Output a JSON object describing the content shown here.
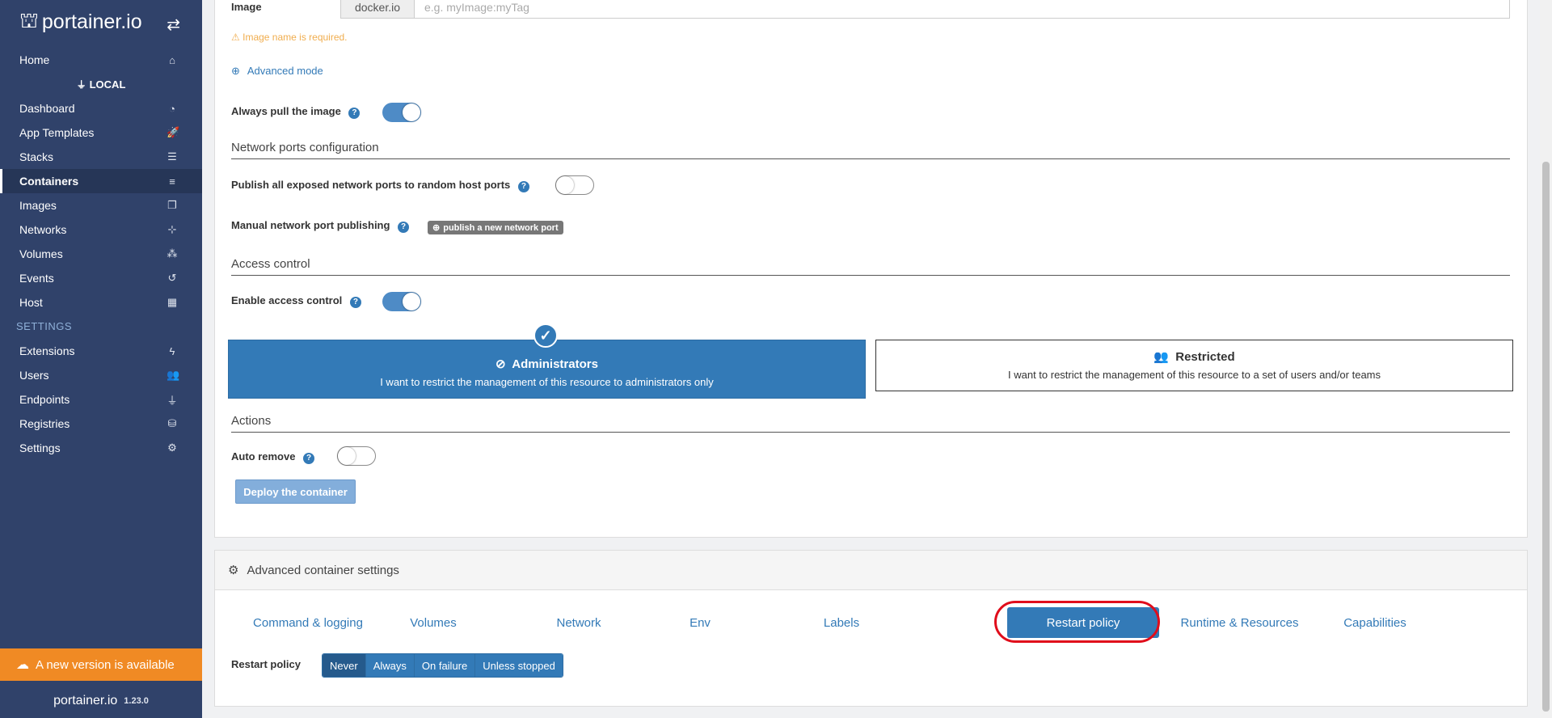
{
  "sidebar": {
    "brand": "portainer.io",
    "home": "Home",
    "endpoint_header": "LOCAL",
    "items": [
      {
        "label": "Dashboard",
        "icon": "dashboard-icon",
        "glyph": "◔"
      },
      {
        "label": "App Templates",
        "icon": "rocket-icon",
        "glyph": "🚀"
      },
      {
        "label": "Stacks",
        "icon": "list-icon",
        "glyph": "☰"
      },
      {
        "label": "Containers",
        "icon": "server-icon",
        "glyph": "≡"
      },
      {
        "label": "Images",
        "icon": "clone-icon",
        "glyph": "❐"
      },
      {
        "label": "Networks",
        "icon": "sitemap-icon",
        "glyph": "⊹"
      },
      {
        "label": "Volumes",
        "icon": "cubes-icon",
        "glyph": "⁂"
      },
      {
        "label": "Events",
        "icon": "history-icon",
        "glyph": "↺"
      },
      {
        "label": "Host",
        "icon": "th-icon",
        "glyph": "▦"
      }
    ],
    "settings_section": "SETTINGS",
    "settings_items": [
      {
        "label": "Extensions",
        "icon": "bolt-icon",
        "glyph": "ϟ"
      },
      {
        "label": "Users",
        "icon": "users-icon",
        "glyph": "👥"
      },
      {
        "label": "Endpoints",
        "icon": "plug-icon",
        "glyph": "⏚"
      },
      {
        "label": "Registries",
        "icon": "database-icon",
        "glyph": "⛁"
      },
      {
        "label": "Settings",
        "icon": "cogs-icon",
        "glyph": "⚙"
      }
    ],
    "update_banner": "A new version is available",
    "footer_brand": "portainer.io",
    "version": "1.23.0"
  },
  "form": {
    "image_label": "Image",
    "registry_addon": "docker.io",
    "image_placeholder": "e.g. myImage:myTag",
    "image_value": "",
    "image_error": "Image name is required.",
    "advanced_mode": "Advanced mode",
    "always_pull_label": "Always pull the image",
    "always_pull": true,
    "network_section": "Network ports configuration",
    "publish_all_label": "Publish all exposed network ports to random host ports",
    "publish_all": false,
    "manual_port_label": "Manual network port publishing",
    "publish_port_button": "publish a new network port",
    "access_section": "Access control",
    "enable_access_label": "Enable access control",
    "enable_access": true,
    "admin_title": "Administrators",
    "admin_desc": "I want to restrict the management of this resource to administrators only",
    "restricted_title": "Restricted",
    "restricted_desc": "I want to restrict the management of this resource to a set of users and/or teams",
    "actions_section": "Actions",
    "auto_remove_label": "Auto remove",
    "auto_remove": false,
    "deploy_button": "Deploy the container"
  },
  "advanced": {
    "header": "Advanced container settings",
    "tabs": [
      {
        "label": "Command & logging",
        "active": false
      },
      {
        "label": "Volumes",
        "active": false
      },
      {
        "label": "Network",
        "active": false
      },
      {
        "label": "Env",
        "active": false
      },
      {
        "label": "Labels",
        "active": false
      },
      {
        "label": "Restart policy",
        "active": true
      },
      {
        "label": "Runtime & Resources",
        "active": false
      },
      {
        "label": "Capabilities",
        "active": false
      }
    ],
    "restart_label": "Restart policy",
    "restart_options": [
      {
        "label": "Never",
        "active": true
      },
      {
        "label": "Always",
        "active": false
      },
      {
        "label": "On failure",
        "active": false
      },
      {
        "label": "Unless stopped",
        "active": false
      }
    ]
  },
  "colors": {
    "sidebar_bg": "#30426a",
    "primary": "#337ab7",
    "warning": "#f0ad4e",
    "banner": "#f08a24",
    "highlight": "#e00d1b"
  }
}
